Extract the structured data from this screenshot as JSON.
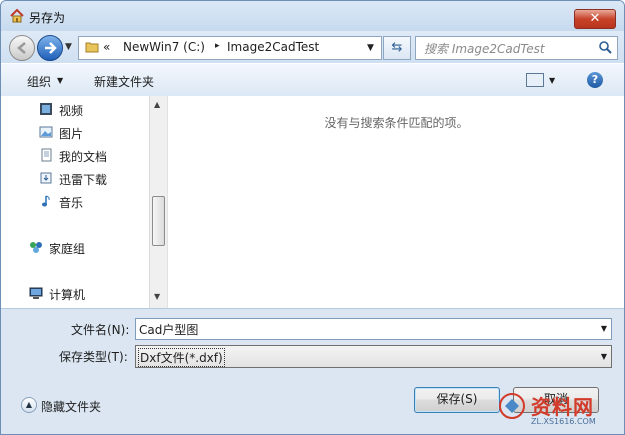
{
  "window": {
    "title": "另存为",
    "close_label": "✕"
  },
  "nav": {
    "address": {
      "chevrons": "«",
      "segments": [
        "NewWin7 (C:)",
        "Image2CadTest"
      ],
      "separator": "▸"
    },
    "search_placeholder": "搜索 Image2CadTest"
  },
  "toolbar": {
    "organize_label": "组织",
    "new_folder_label": "新建文件夹",
    "help_label": "?"
  },
  "sidebar": {
    "items": [
      {
        "label": "视频",
        "icon": "video-icon"
      },
      {
        "label": "图片",
        "icon": "picture-icon"
      },
      {
        "label": "我的文档",
        "icon": "document-icon"
      },
      {
        "label": "迅雷下载",
        "icon": "download-icon"
      },
      {
        "label": "音乐",
        "icon": "music-icon"
      },
      {
        "label": "家庭组",
        "icon": "homegroup-icon"
      },
      {
        "label": "计算机",
        "icon": "computer-icon"
      }
    ]
  },
  "main": {
    "empty_message": "没有与搜索条件匹配的项。"
  },
  "form": {
    "filename_label": "文件名(N):",
    "filename_value": "Cad户型图",
    "filetype_label": "保存类型(T):",
    "filetype_value": "Dxf文件(*.dxf)"
  },
  "footer": {
    "hide_folders_label": "隐藏文件夹",
    "save_label": "保存(S)",
    "cancel_label": "取消"
  },
  "watermark": {
    "text": "资料网",
    "url": "ZL.XS1616.COM"
  },
  "colors": {
    "accent": "#3c7fb1",
    "close": "#c7432a",
    "chrome": "#c9dcef"
  }
}
